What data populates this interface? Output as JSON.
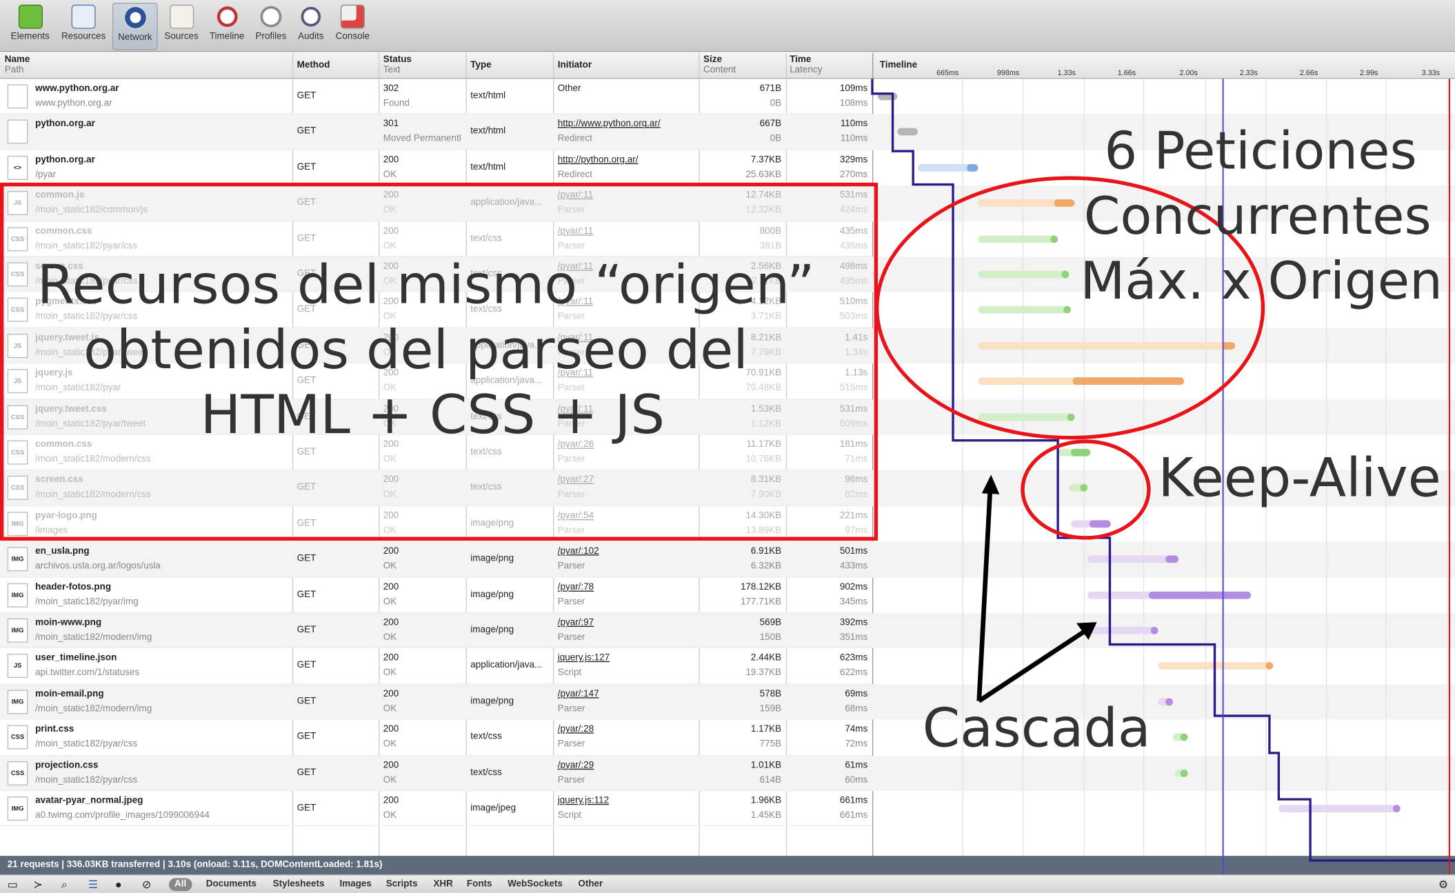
{
  "toolbar": [
    {
      "label": "Elements",
      "icon": "elements-icon",
      "color": "#5fae3a"
    },
    {
      "label": "Resources",
      "icon": "resources-icon",
      "color": "#4d79c4"
    },
    {
      "label": "Network",
      "icon": "network-icon",
      "color": "#2e4f9a",
      "selected": true
    },
    {
      "label": "Sources",
      "icon": "sources-icon",
      "color": "#c94c3a"
    },
    {
      "label": "Timeline",
      "icon": "timeline-icon",
      "color": "#b33"
    },
    {
      "label": "Profiles",
      "icon": "profiles-icon",
      "color": "#888"
    },
    {
      "label": "Audits",
      "icon": "audits-icon",
      "color": "#557"
    },
    {
      "label": "Console",
      "icon": "console-icon",
      "color": "#d44"
    }
  ],
  "columns": {
    "name": "Name",
    "path": "Path",
    "method": "Method",
    "status": "Status",
    "text": "Text",
    "type": "Type",
    "initiator": "Initiator",
    "size": "Size",
    "content": "Content",
    "time": "Time",
    "latency": "Latency",
    "timeline": "Timeline"
  },
  "ticks": [
    "665ms",
    "998ms",
    "1.33s",
    "1.66s",
    "2.00s",
    "2.33s",
    "2.66s",
    "2.99s",
    "3.33s"
  ],
  "requests": [
    {
      "icon": "",
      "name": "www.python.org.ar",
      "path": "www.python.org.ar",
      "method": "GET",
      "status": "302",
      "text": "Found",
      "type": "text/html",
      "initiator": "Other",
      "initiator_type": "",
      "size": "671B",
      "content": "0B",
      "time": "109ms",
      "latency": "108ms",
      "dim": false,
      "link": false,
      "bar": {
        "start": 0.2,
        "wait": 0.2,
        "end": 0.31,
        "kind": "gray"
      }
    },
    {
      "icon": "",
      "name": "python.org.ar",
      "path": "",
      "method": "GET",
      "status": "301",
      "text": "Moved Permanentl",
      "type": "text/html",
      "initiator": "http://www.python.org.ar/",
      "initiator_type": "Redirect",
      "size": "667B",
      "content": "0B",
      "time": "110ms",
      "latency": "110ms",
      "dim": false,
      "link": true,
      "bar": {
        "start": 0.31,
        "wait": 0.31,
        "end": 0.42,
        "kind": "gray"
      }
    },
    {
      "icon": "<>",
      "name": "python.org.ar",
      "path": "/pyar",
      "method": "GET",
      "status": "200",
      "text": "OK",
      "type": "text/html",
      "initiator": "http://python.org.ar/",
      "initiator_type": "Redirect",
      "size": "7.37KB",
      "content": "25.63KB",
      "time": "329ms",
      "latency": "270ms",
      "dim": false,
      "link": true,
      "bar": {
        "start": 0.42,
        "wait": 0.69,
        "end": 0.75,
        "kind": "blue"
      }
    },
    {
      "icon": "JS",
      "name": "common.js",
      "path": "/moin_static182/common/js",
      "method": "GET",
      "status": "200",
      "text": "OK",
      "type": "application/java...",
      "initiator": "/pyar/:11",
      "initiator_type": "Parser",
      "size": "12.74KB",
      "content": "12.32KB",
      "time": "531ms",
      "latency": "424ms",
      "dim": true,
      "link": true,
      "bar": {
        "start": 0.75,
        "wait": 1.17,
        "end": 1.28,
        "kind": "orange"
      }
    },
    {
      "icon": "CSS",
      "name": "common.css",
      "path": "/moin_static182/pyar/css",
      "method": "GET",
      "status": "200",
      "text": "OK",
      "type": "text/css",
      "initiator": "/pyar/:11",
      "initiator_type": "Parser",
      "size": "800B",
      "content": "381B",
      "time": "435ms",
      "latency": "435ms",
      "dim": true,
      "link": true,
      "bar": {
        "start": 0.75,
        "wait": 1.18,
        "end": 1.19,
        "kind": "green"
      }
    },
    {
      "icon": "CSS",
      "name": "screen.css",
      "path": "/moin_static182/pyar/css",
      "method": "GET",
      "status": "200",
      "text": "OK",
      "type": "text/css",
      "initiator": "/pyar/:11",
      "initiator_type": "Parser",
      "size": "2.56KB",
      "content": "2.11KB",
      "time": "498ms",
      "latency": "495ms",
      "dim": true,
      "link": true,
      "bar": {
        "start": 0.75,
        "wait": 1.24,
        "end": 1.25,
        "kind": "green"
      }
    },
    {
      "icon": "CSS",
      "name": "pygments.css",
      "path": "/moin_static182/pyar/css",
      "method": "GET",
      "status": "200",
      "text": "OK",
      "type": "text/css",
      "initiator": "/pyar/:11",
      "initiator_type": "Parser",
      "size": "4.12KB",
      "content": "3.71KB",
      "time": "510ms",
      "latency": "503ms",
      "dim": true,
      "link": true,
      "bar": {
        "start": 0.75,
        "wait": 1.25,
        "end": 1.26,
        "kind": "green"
      }
    },
    {
      "icon": "JS",
      "name": "jquery.tweet.js",
      "path": "/moin_static182/pyar/tweet",
      "method": "GET",
      "status": "200",
      "text": "OK",
      "type": "application/java...",
      "initiator": "/pyar/:11",
      "initiator_type": "Parser",
      "size": "8.21KB",
      "content": "7.79KB",
      "time": "1.41s",
      "latency": "1.34s",
      "dim": true,
      "link": true,
      "bar": {
        "start": 0.75,
        "wait": 2.09,
        "end": 2.16,
        "kind": "orange"
      }
    },
    {
      "icon": "JS",
      "name": "jquery.js",
      "path": "/moin_static182/pyar",
      "method": "GET",
      "status": "200",
      "text": "OK",
      "type": "application/java...",
      "initiator": "/pyar/:11",
      "initiator_type": "Parser",
      "size": "70.91KB",
      "content": "70.48KB",
      "time": "1.13s",
      "latency": "515ms",
      "dim": true,
      "link": true,
      "bar": {
        "start": 0.75,
        "wait": 1.27,
        "end": 1.88,
        "kind": "orange"
      }
    },
    {
      "icon": "CSS",
      "name": "jquery.tweet.css",
      "path": "/moin_static182/pyar/tweet",
      "method": "GET",
      "status": "200",
      "text": "OK",
      "type": "text/css",
      "initiator": "/pyar/:11",
      "initiator_type": "Parser",
      "size": "1.53KB",
      "content": "1.12KB",
      "time": "531ms",
      "latency": "509ms",
      "dim": true,
      "link": true,
      "bar": {
        "start": 0.75,
        "wait": 1.26,
        "end": 1.28,
        "kind": "green"
      }
    },
    {
      "icon": "CSS",
      "name": "common.css",
      "path": "/moin_static182/modern/css",
      "method": "GET",
      "status": "200",
      "text": "OK",
      "type": "text/css",
      "initiator": "/pyar/:26",
      "initiator_type": "Parser",
      "size": "11.17KB",
      "content": "10.76KB",
      "time": "181ms",
      "latency": "71ms",
      "dim": true,
      "link": true,
      "bar": {
        "start": 1.19,
        "wait": 1.26,
        "end": 1.37,
        "kind": "green"
      }
    },
    {
      "icon": "CSS",
      "name": "screen.css",
      "path": "/moin_static182/modern/css",
      "method": "GET",
      "status": "200",
      "text": "OK",
      "type": "text/css",
      "initiator": "/pyar/:27",
      "initiator_type": "Parser",
      "size": "8.31KB",
      "content": "7.90KB",
      "time": "96ms",
      "latency": "82ms",
      "dim": true,
      "link": true,
      "bar": {
        "start": 1.25,
        "wait": 1.33,
        "end": 1.35,
        "kind": "green"
      }
    },
    {
      "icon": "IMG",
      "name": "pyar-logo.png",
      "path": "/images",
      "method": "GET",
      "status": "200",
      "text": "OK",
      "type": "image/png",
      "initiator": "/pyar/:54",
      "initiator_type": "Parser",
      "size": "14.30KB",
      "content": "13.89KB",
      "time": "221ms",
      "latency": "97ms",
      "dim": true,
      "link": true,
      "bar": {
        "start": 1.26,
        "wait": 1.36,
        "end": 1.48,
        "kind": "purple"
      }
    },
    {
      "icon": "IMG",
      "name": "en_usla.png",
      "path": "archivos.usla.org.ar/logos/usla",
      "method": "GET",
      "status": "200",
      "text": "OK",
      "type": "image/png",
      "initiator": "/pyar/:102",
      "initiator_type": "Parser",
      "size": "6.91KB",
      "content": "6.32KB",
      "time": "501ms",
      "latency": "433ms",
      "dim": false,
      "link": true,
      "bar": {
        "start": 1.35,
        "wait": 1.78,
        "end": 1.85,
        "kind": "purple"
      }
    },
    {
      "icon": "IMG",
      "name": "header-fotos.png",
      "path": "/moin_static182/pyar/img",
      "method": "GET",
      "status": "200",
      "text": "OK",
      "type": "image/png",
      "initiator": "/pyar/:78",
      "initiator_type": "Parser",
      "size": "178.12KB",
      "content": "177.71KB",
      "time": "902ms",
      "latency": "345ms",
      "dim": false,
      "link": true,
      "bar": {
        "start": 1.35,
        "wait": 1.69,
        "end": 2.25,
        "kind": "purple"
      }
    },
    {
      "icon": "IMG",
      "name": "moin-www.png",
      "path": "/moin_static182/modern/img",
      "method": "GET",
      "status": "200",
      "text": "OK",
      "type": "image/png",
      "initiator": "/pyar/:97",
      "initiator_type": "Parser",
      "size": "569B",
      "content": "150B",
      "time": "392ms",
      "latency": "351ms",
      "dim": false,
      "link": true,
      "bar": {
        "start": 1.35,
        "wait": 1.7,
        "end": 1.74,
        "kind": "purple"
      }
    },
    {
      "icon": "JS",
      "name": "user_timeline.json",
      "path": "api.twitter.com/1/statuses",
      "method": "GET",
      "status": "200",
      "text": "OK",
      "type": "application/java...",
      "initiator": "jquery.js:127",
      "initiator_type": "Script",
      "size": "2.44KB",
      "content": "19.37KB",
      "time": "623ms",
      "latency": "622ms",
      "dim": false,
      "link": true,
      "bar": {
        "start": 1.74,
        "wait": 2.36,
        "end": 2.37,
        "kind": "orange"
      }
    },
    {
      "icon": "IMG",
      "name": "moin-email.png",
      "path": "/moin_static182/modern/img",
      "method": "GET",
      "status": "200",
      "text": "OK",
      "type": "image/png",
      "initiator": "/pyar/:147",
      "initiator_type": "Parser",
      "size": "578B",
      "content": "159B",
      "time": "69ms",
      "latency": "68ms",
      "dim": false,
      "link": true,
      "bar": {
        "start": 1.74,
        "wait": 1.81,
        "end": 1.82,
        "kind": "purple"
      }
    },
    {
      "icon": "CSS",
      "name": "print.css",
      "path": "/moin_static182/pyar/css",
      "method": "GET",
      "status": "200",
      "text": "OK",
      "type": "text/css",
      "initiator": "/pyar/:28",
      "initiator_type": "Parser",
      "size": "1.17KB",
      "content": "775B",
      "time": "74ms",
      "latency": "72ms",
      "dim": false,
      "link": true,
      "bar": {
        "start": 1.82,
        "wait": 1.89,
        "end": 1.9,
        "kind": "green"
      }
    },
    {
      "icon": "CSS",
      "name": "projection.css",
      "path": "/moin_static182/pyar/css",
      "method": "GET",
      "status": "200",
      "text": "OK",
      "type": "text/css",
      "initiator": "/pyar/:29",
      "initiator_type": "Parser",
      "size": "1.01KB",
      "content": "614B",
      "time": "61ms",
      "latency": "60ms",
      "dim": false,
      "link": true,
      "bar": {
        "start": 1.83,
        "wait": 1.89,
        "end": 1.9,
        "kind": "green"
      }
    },
    {
      "icon": "IMG",
      "name": "avatar-pyar_normal.jpeg",
      "path": "a0.twimg.com/profile_images/1099006944",
      "method": "GET",
      "status": "200",
      "text": "OK",
      "type": "image/jpeg",
      "initiator": "jquery.js:112",
      "initiator_type": "Script",
      "size": "1.96KB",
      "content": "1.45KB",
      "time": "661ms",
      "latency": "661ms",
      "dim": false,
      "link": true,
      "bar": {
        "start": 2.4,
        "wait": 3.06,
        "end": 3.07,
        "kind": "purple"
      }
    }
  ],
  "timeline_scale": {
    "t0": 0.17,
    "t1": 3.37,
    "dom_content_loaded": 1.81,
    "onload": 3.11
  },
  "bar_colors": {
    "gray": [
      "#e0e0e0",
      "#b5b5b5"
    ],
    "blue": [
      "#cfe0f6",
      "#7fa8e0"
    ],
    "orange": [
      "#fbe0c6",
      "#f0a868"
    ],
    "green": [
      "#d3efc8",
      "#8fd27a"
    ],
    "purple": [
      "#e5d8f3",
      "#b38de0"
    ]
  },
  "status": {
    "summary": "21 requests  |  336.03KB transferred  |  3.10s (onload: 3.11s, DOMContentLoaded: 1.81s)"
  },
  "filters": [
    "All",
    "Documents",
    "Stylesheets",
    "Images",
    "Scripts",
    "XHR",
    "Fonts",
    "WebSockets",
    "Other"
  ],
  "annotations": {
    "recursos": [
      "Recursos del mismo “origen”",
      "obtenidos del parseo del",
      "HTML + CSS + JS"
    ],
    "peticiones": [
      "6 Peticiones",
      "Concurrentes",
      "Máx. x Origen"
    ],
    "keepalive": "Keep-Alive",
    "cascada": "Cascada",
    "accent": "#e8141a",
    "cascade_color": "#2a1a8a"
  }
}
